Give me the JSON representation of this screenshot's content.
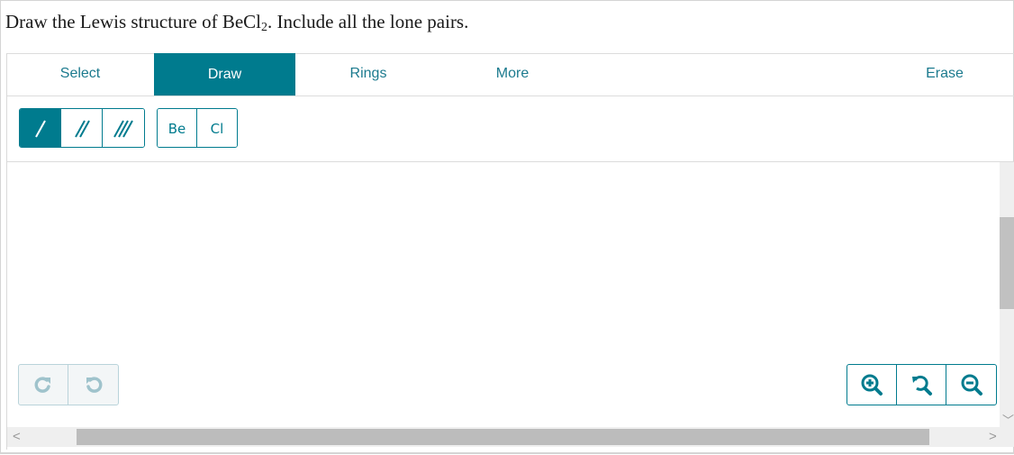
{
  "question": {
    "prefix": "Draw the Lewis structure of BeCl",
    "subscript": "2",
    "suffix": ". Include all the lone pairs."
  },
  "tabs": [
    {
      "label": "Select",
      "active": false
    },
    {
      "label": "Draw",
      "active": true
    },
    {
      "label": "Rings",
      "active": false
    },
    {
      "label": "More",
      "active": false
    },
    {
      "label": "Erase",
      "active": false
    }
  ],
  "bond_tools": [
    {
      "name": "single-bond",
      "selected": true
    },
    {
      "name": "double-bond",
      "selected": false
    },
    {
      "name": "triple-bond",
      "selected": false
    }
  ],
  "atoms": [
    "Be",
    "Cl"
  ],
  "colors": {
    "accent": "#007b8e",
    "accent_text": "#1b7a8e",
    "disabled": "#9fc3cc"
  }
}
